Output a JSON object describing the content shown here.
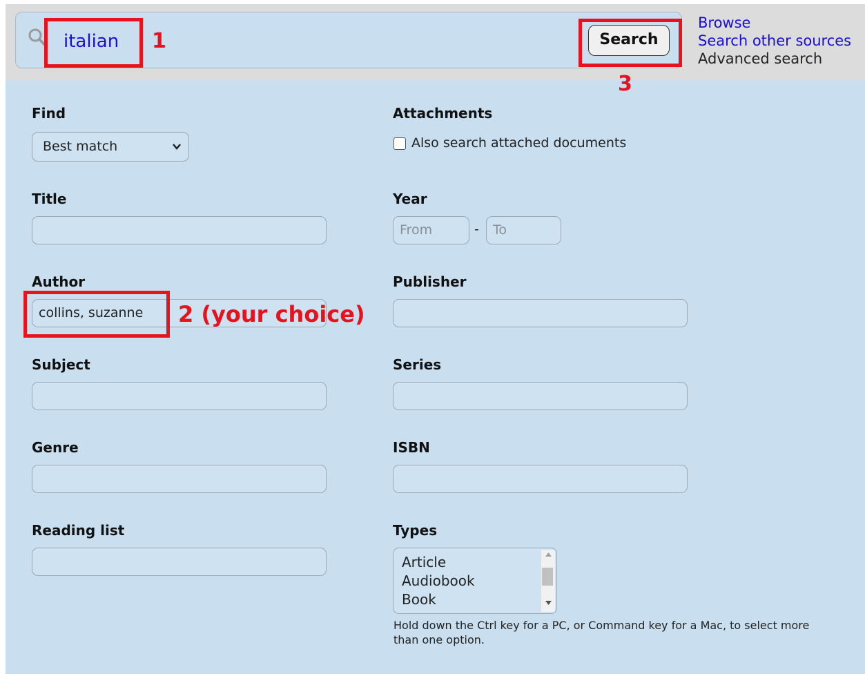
{
  "search": {
    "query": "italian",
    "button_label": "Search"
  },
  "toplinks": {
    "browse": "Browse",
    "other_sources": "Search other sources",
    "advanced": "Advanced search"
  },
  "form": {
    "find": {
      "label": "Find",
      "value": "Best match"
    },
    "attachments": {
      "label": "Attachments",
      "checkbox_label": "Also search attached documents",
      "checked": false
    },
    "title": {
      "label": "Title",
      "value": ""
    },
    "year": {
      "label": "Year",
      "from_placeholder": "From",
      "to_placeholder": "To",
      "separator": "-"
    },
    "author": {
      "label": "Author",
      "value": "collins, suzanne"
    },
    "publisher": {
      "label": "Publisher",
      "value": ""
    },
    "subject": {
      "label": "Subject",
      "value": ""
    },
    "series": {
      "label": "Series",
      "value": ""
    },
    "genre": {
      "label": "Genre",
      "value": ""
    },
    "isbn": {
      "label": "ISBN",
      "value": ""
    },
    "reading_list": {
      "label": "Reading list",
      "value": ""
    },
    "types": {
      "label": "Types",
      "options": [
        "Article",
        "Audiobook",
        "Book"
      ],
      "hint": "Hold down the Ctrl key for a PC, or Command key for a Mac, to select more than one option."
    }
  },
  "annotations": {
    "one": "1",
    "two": "2 (your choice)",
    "three": "3"
  },
  "colors": {
    "accent_red": "#e8121c",
    "link_blue": "#1a0dd6",
    "panel_bg": "#c9dff0"
  }
}
